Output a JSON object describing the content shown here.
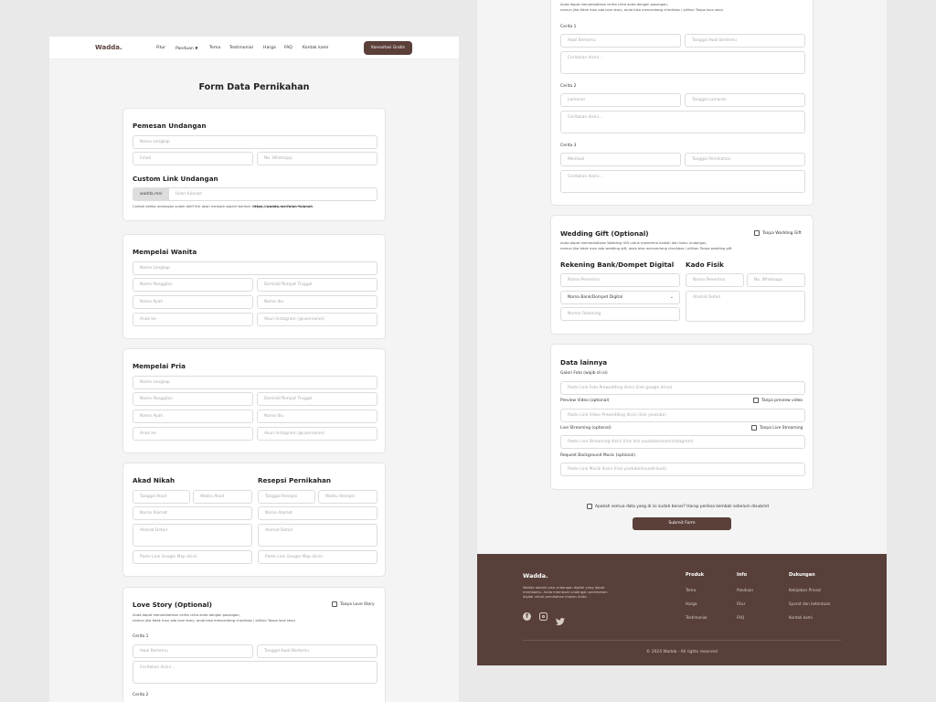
{
  "header": {
    "brand": "Wadda.",
    "nav": [
      "Fitur",
      "Panduan",
      "Tema",
      "Testimonial",
      "Harga",
      "FAQ",
      "Kontak kami"
    ],
    "cta": "Konsultasi Gratis"
  },
  "page_title": "Form Data Pernikahan",
  "pemesan": {
    "title": "Pemesan Undangan",
    "name_ph": "Nama Lengkap",
    "email_ph": "Email",
    "wa_ph": "No. Whatsapp"
  },
  "custom_link": {
    "title": "Custom Link Undangan",
    "prefix": "wadda.me/",
    "ph": "fulan-fulanah",
    "note_a": "Contoh ketika undangan sudah aktif link akan menjadi seperti berikut: ",
    "note_b": "https://wadda.me/fulan-fulanah"
  },
  "wanita": {
    "title": "Mempelai Wanita",
    "name_ph": "Nama Lengkap",
    "nick_ph": "Nama Panggilan",
    "domicile_ph": "Domisili/Tempat Tinggal",
    "father_ph": "Nama Ayah",
    "mother_ph": "Nama Ibu",
    "child_ph": "Anak ke-",
    "ig_ph": "Akun Instagram (@username)"
  },
  "pria": {
    "title": "Mempelai Pria",
    "name_ph": "Nama Lengkap",
    "nick_ph": "Nama Panggilan",
    "domicile_ph": "Domisili/Tempat Tinggal",
    "father_ph": "Nama Ayah",
    "mother_ph": "Nama Ibu",
    "child_ph": "Anak ke-",
    "ig_ph": "Akun Instagram (@username)"
  },
  "akad": {
    "title": "Akad Nikah",
    "date_ph": "Tanggal Akad",
    "time_ph": "Waktu Akad",
    "place_ph": "Nama Alamat",
    "address_ph": "Alamat Detail",
    "map_ph": "Paste Link Google Map disini"
  },
  "resepsi": {
    "title": "Resepsi Pernikahan",
    "date_ph": "Tanggal Resepsi",
    "time_ph": "Waktu Resepsi",
    "place_ph": "Nama Alamat",
    "address_ph": "Alamat Detail",
    "map_ph": "Paste Link Google Map disini"
  },
  "love_story": {
    "title": "Love Story (Optional)",
    "toggle": "Tanpa Love Story",
    "note1": "Anda dapat menambahkan cerita cinta anda dengan pasangan,",
    "note2": "namun jika tidak mau ada love story, anda bisa mencentang checkbox / pilihan Tanpa love story",
    "stories": [
      {
        "label": "Cerita 1",
        "a_ph": "Awal Bertemu",
        "b_ph": "Tanggal Awal Bertemu",
        "text_ph": "Ceritakan disini..."
      },
      {
        "label": "Cerita 2",
        "a_ph": "Lamaran",
        "b_ph": "Tanggal Lamaran",
        "text_ph": "Ceritakan disini..."
      },
      {
        "label": "Cerita 3",
        "a_ph": "Menikah",
        "b_ph": "Tanggal Pernikahan",
        "text_ph": "Ceritakan disini..."
      }
    ]
  },
  "gift": {
    "title": "Wedding Gift (Optional)",
    "toggle": "Tanpa Wedding Gift",
    "note1": "Anda dapat menambahkan Wedding Gift untuk menerima hadiah dari tamu undangan,",
    "note2": "namun jika tidak mau ada wedding gift, anda bisa mencentang checkbox / pilihan Tanpa wedding gift",
    "bank_title": "Rekening Bank/Dompet Digital",
    "recipient_ph": "Nama Penerima",
    "bank_select": "Nama Bank/Dompet Digital",
    "account_ph": "Nomor Rekening",
    "kado_title": "Kado Fisik",
    "kado_name_ph": "Nama Penerima",
    "kado_wa_ph": "No. Whatsapp",
    "kado_address_ph": "Alamat Detail"
  },
  "lainnya": {
    "title": "Data lainnya",
    "photo_label": "Galeri Foto (wajib di isi)",
    "photo_ph": "Paste Link Foto Prewedding disini (link google drive)",
    "video_label": "Preview Video (optional)",
    "video_toggle": "Tanpa preview video",
    "video_ph": "Paste Link Video Prewedding disini (link youtube)",
    "stream_label": "Live Streaming (optional)",
    "stream_toggle": "Tanpa Live Streaming",
    "stream_ph": "Paste Live Streaming disini (link link youtube/zoom/instagram)",
    "music_label": "Request Background Music (optional)",
    "music_ph": "Paste Link Musik disini (link youtube/soundcloud)"
  },
  "confirm": "Apakah semua data yang di isi sudah benar? Harap periksa kembali sebelum disubmit",
  "submit": "Submit Form",
  "footer": {
    "brand": "Wadda.",
    "desc1": "Wadda adalah jasa undangan digital yang dapat",
    "desc2": "membantu. Anda membuat undangan pernikahan",
    "desc3": "digital untuk pernikahan impian Anda.",
    "cols": [
      {
        "title": "Produk",
        "links": [
          "Tema",
          "Harga",
          "Testimonial"
        ]
      },
      {
        "title": "Info",
        "links": [
          "Panduan",
          "Fitur",
          "FAQ"
        ]
      },
      {
        "title": "Dukungan",
        "links": [
          "Kebijakan Privasi",
          "Syarat dan ketentuan",
          "Kontak kami"
        ]
      }
    ],
    "copyright": "© 2024 Wadda - All rights reserved"
  },
  "colors": {
    "brand": "#5b3f39",
    "footer_bg": "#583f39"
  },
  "icons": [
    "chevron-down-icon",
    "facebook-icon",
    "instagram-icon",
    "twitter-icon"
  ]
}
